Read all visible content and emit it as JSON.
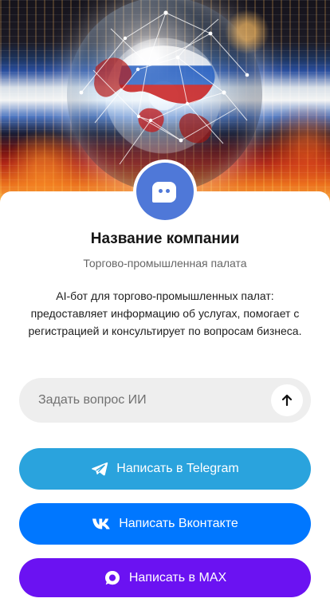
{
  "profile": {
    "name": "Название компании",
    "subtitle": "Торгово-промышленная палата",
    "description": "AI-бот для торгово-промышленных палат: предоставляет информацию об услугах, помогает с регистрацией и консультирует по вопросам бизнеса.",
    "avatar_icon": "chat-bot-icon",
    "avatar_color": "#4f78d8"
  },
  "ask": {
    "placeholder": "Задать вопрос ИИ",
    "send_icon": "arrow-up-icon"
  },
  "actions": {
    "telegram": {
      "label": "Написать в Telegram",
      "icon": "telegram-icon",
      "color": "#2aa3dd"
    },
    "vk": {
      "label": "Написать Вконтакте",
      "icon": "vk-icon",
      "color": "#0077ff"
    },
    "max": {
      "label": "Написать в MAX",
      "icon": "max-chat-icon",
      "color": "#6b12f2"
    }
  },
  "hero": {
    "image": "globe-network-russian-flag-banner"
  }
}
